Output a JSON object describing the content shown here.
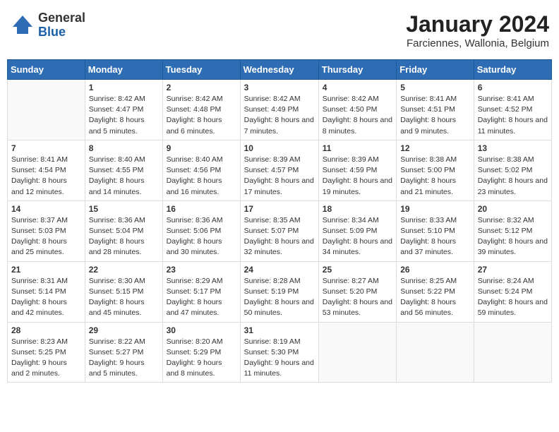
{
  "header": {
    "logo_general": "General",
    "logo_blue": "Blue",
    "month": "January 2024",
    "location": "Farciennes, Wallonia, Belgium"
  },
  "days_of_week": [
    "Sunday",
    "Monday",
    "Tuesday",
    "Wednesday",
    "Thursday",
    "Friday",
    "Saturday"
  ],
  "weeks": [
    [
      {
        "day": "",
        "empty": true
      },
      {
        "day": "1",
        "sunrise": "Sunrise: 8:42 AM",
        "sunset": "Sunset: 4:47 PM",
        "daylight": "Daylight: 8 hours and 5 minutes."
      },
      {
        "day": "2",
        "sunrise": "Sunrise: 8:42 AM",
        "sunset": "Sunset: 4:48 PM",
        "daylight": "Daylight: 8 hours and 6 minutes."
      },
      {
        "day": "3",
        "sunrise": "Sunrise: 8:42 AM",
        "sunset": "Sunset: 4:49 PM",
        "daylight": "Daylight: 8 hours and 7 minutes."
      },
      {
        "day": "4",
        "sunrise": "Sunrise: 8:42 AM",
        "sunset": "Sunset: 4:50 PM",
        "daylight": "Daylight: 8 hours and 8 minutes."
      },
      {
        "day": "5",
        "sunrise": "Sunrise: 8:41 AM",
        "sunset": "Sunset: 4:51 PM",
        "daylight": "Daylight: 8 hours and 9 minutes."
      },
      {
        "day": "6",
        "sunrise": "Sunrise: 8:41 AM",
        "sunset": "Sunset: 4:52 PM",
        "daylight": "Daylight: 8 hours and 11 minutes."
      }
    ],
    [
      {
        "day": "7",
        "sunrise": "Sunrise: 8:41 AM",
        "sunset": "Sunset: 4:54 PM",
        "daylight": "Daylight: 8 hours and 12 minutes."
      },
      {
        "day": "8",
        "sunrise": "Sunrise: 8:40 AM",
        "sunset": "Sunset: 4:55 PM",
        "daylight": "Daylight: 8 hours and 14 minutes."
      },
      {
        "day": "9",
        "sunrise": "Sunrise: 8:40 AM",
        "sunset": "Sunset: 4:56 PM",
        "daylight": "Daylight: 8 hours and 16 minutes."
      },
      {
        "day": "10",
        "sunrise": "Sunrise: 8:39 AM",
        "sunset": "Sunset: 4:57 PM",
        "daylight": "Daylight: 8 hours and 17 minutes."
      },
      {
        "day": "11",
        "sunrise": "Sunrise: 8:39 AM",
        "sunset": "Sunset: 4:59 PM",
        "daylight": "Daylight: 8 hours and 19 minutes."
      },
      {
        "day": "12",
        "sunrise": "Sunrise: 8:38 AM",
        "sunset": "Sunset: 5:00 PM",
        "daylight": "Daylight: 8 hours and 21 minutes."
      },
      {
        "day": "13",
        "sunrise": "Sunrise: 8:38 AM",
        "sunset": "Sunset: 5:02 PM",
        "daylight": "Daylight: 8 hours and 23 minutes."
      }
    ],
    [
      {
        "day": "14",
        "sunrise": "Sunrise: 8:37 AM",
        "sunset": "Sunset: 5:03 PM",
        "daylight": "Daylight: 8 hours and 25 minutes."
      },
      {
        "day": "15",
        "sunrise": "Sunrise: 8:36 AM",
        "sunset": "Sunset: 5:04 PM",
        "daylight": "Daylight: 8 hours and 28 minutes."
      },
      {
        "day": "16",
        "sunrise": "Sunrise: 8:36 AM",
        "sunset": "Sunset: 5:06 PM",
        "daylight": "Daylight: 8 hours and 30 minutes."
      },
      {
        "day": "17",
        "sunrise": "Sunrise: 8:35 AM",
        "sunset": "Sunset: 5:07 PM",
        "daylight": "Daylight: 8 hours and 32 minutes."
      },
      {
        "day": "18",
        "sunrise": "Sunrise: 8:34 AM",
        "sunset": "Sunset: 5:09 PM",
        "daylight": "Daylight: 8 hours and 34 minutes."
      },
      {
        "day": "19",
        "sunrise": "Sunrise: 8:33 AM",
        "sunset": "Sunset: 5:10 PM",
        "daylight": "Daylight: 8 hours and 37 minutes."
      },
      {
        "day": "20",
        "sunrise": "Sunrise: 8:32 AM",
        "sunset": "Sunset: 5:12 PM",
        "daylight": "Daylight: 8 hours and 39 minutes."
      }
    ],
    [
      {
        "day": "21",
        "sunrise": "Sunrise: 8:31 AM",
        "sunset": "Sunset: 5:14 PM",
        "daylight": "Daylight: 8 hours and 42 minutes."
      },
      {
        "day": "22",
        "sunrise": "Sunrise: 8:30 AM",
        "sunset": "Sunset: 5:15 PM",
        "daylight": "Daylight: 8 hours and 45 minutes."
      },
      {
        "day": "23",
        "sunrise": "Sunrise: 8:29 AM",
        "sunset": "Sunset: 5:17 PM",
        "daylight": "Daylight: 8 hours and 47 minutes."
      },
      {
        "day": "24",
        "sunrise": "Sunrise: 8:28 AM",
        "sunset": "Sunset: 5:19 PM",
        "daylight": "Daylight: 8 hours and 50 minutes."
      },
      {
        "day": "25",
        "sunrise": "Sunrise: 8:27 AM",
        "sunset": "Sunset: 5:20 PM",
        "daylight": "Daylight: 8 hours and 53 minutes."
      },
      {
        "day": "26",
        "sunrise": "Sunrise: 8:25 AM",
        "sunset": "Sunset: 5:22 PM",
        "daylight": "Daylight: 8 hours and 56 minutes."
      },
      {
        "day": "27",
        "sunrise": "Sunrise: 8:24 AM",
        "sunset": "Sunset: 5:24 PM",
        "daylight": "Daylight: 8 hours and 59 minutes."
      }
    ],
    [
      {
        "day": "28",
        "sunrise": "Sunrise: 8:23 AM",
        "sunset": "Sunset: 5:25 PM",
        "daylight": "Daylight: 9 hours and 2 minutes."
      },
      {
        "day": "29",
        "sunrise": "Sunrise: 8:22 AM",
        "sunset": "Sunset: 5:27 PM",
        "daylight": "Daylight: 9 hours and 5 minutes."
      },
      {
        "day": "30",
        "sunrise": "Sunrise: 8:20 AM",
        "sunset": "Sunset: 5:29 PM",
        "daylight": "Daylight: 9 hours and 8 minutes."
      },
      {
        "day": "31",
        "sunrise": "Sunrise: 8:19 AM",
        "sunset": "Sunset: 5:30 PM",
        "daylight": "Daylight: 9 hours and 11 minutes."
      },
      {
        "day": "",
        "empty": true
      },
      {
        "day": "",
        "empty": true
      },
      {
        "day": "",
        "empty": true
      }
    ]
  ]
}
